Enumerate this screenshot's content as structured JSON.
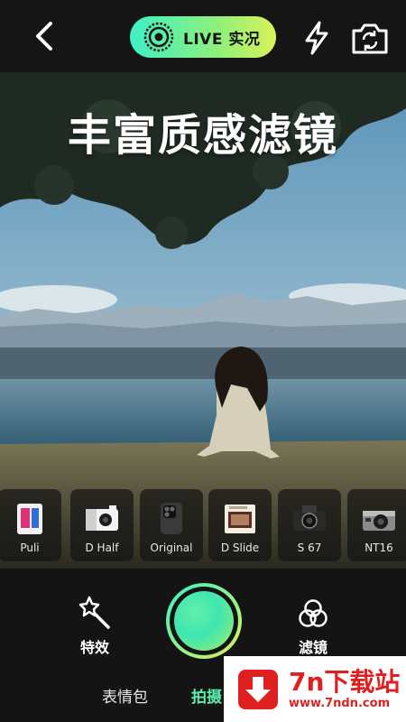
{
  "header": {
    "live_label": "LIVE 实况"
  },
  "preview": {
    "headline": "丰富质感滤镜"
  },
  "filters": [
    {
      "label": "Puli",
      "icon": "instant-camera-icon"
    },
    {
      "label": "D Half",
      "icon": "half-frame-camera-icon"
    },
    {
      "label": "Original",
      "icon": "phone-camera-icon"
    },
    {
      "label": "D Slide",
      "icon": "slide-viewer-icon"
    },
    {
      "label": "S 67",
      "icon": "medium-format-camera-icon"
    },
    {
      "label": "NT16",
      "icon": "compact-camera-icon"
    }
  ],
  "tools": {
    "effects_label": "特效",
    "filters_label": "滤镜"
  },
  "modes": {
    "sticker_label": "表情包",
    "shoot_label": "拍摄"
  },
  "watermark": {
    "title": "7n下载站",
    "url": "www.7ndn.com"
  },
  "colors": {
    "accent_start": "#3ef0c4",
    "accent_end": "#d9f25a",
    "active_mode": "#5cf0b0",
    "watermark_red": "#e02020"
  }
}
